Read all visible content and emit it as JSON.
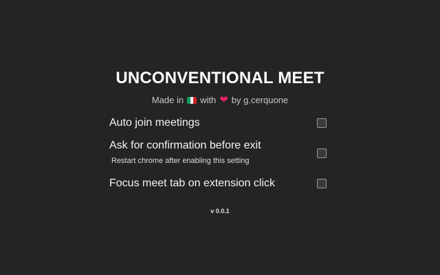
{
  "header": {
    "title": "UNCONVENTIONAL MEET",
    "made_in": "Made in",
    "with": "with",
    "by": "by g.cerquone",
    "flag_icon": "italy-flag-icon",
    "heart_icon": "heart-icon",
    "heart_color": "#e0245e"
  },
  "settings": [
    {
      "label": "Auto join meetings",
      "checked": false
    },
    {
      "label": "Ask for confirmation before exit",
      "note": "Restart chrome after enabling this setting",
      "checked": false
    },
    {
      "label": "Focus meet tab on extension click",
      "checked": false
    }
  ],
  "footer": {
    "version": "v 0.0.1"
  }
}
